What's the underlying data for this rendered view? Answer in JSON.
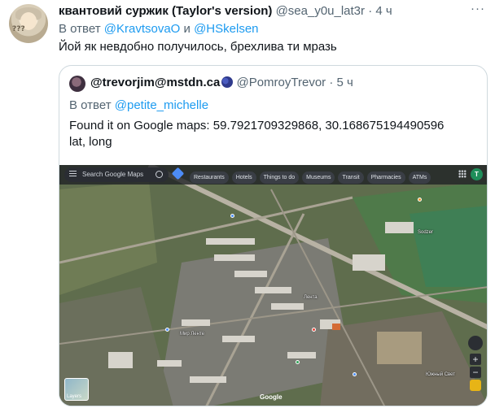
{
  "tweet": {
    "display_name": "квантовий суржик (Taylor's version)",
    "handle": "@sea_y0u_lat3r",
    "separator": "·",
    "time": "4 ч",
    "more_label": "···",
    "reply_prefix": "В ответ",
    "reply_user1": "@KravtsovaO",
    "reply_conj": "и",
    "reply_user2": "@HSkelsen",
    "text": "Йой як невдобно получилось, брехлива ти мразь"
  },
  "quoted": {
    "display_name": "@trevorjim@mstdn.ca",
    "handle": "@PomroyTrevor",
    "separator": "·",
    "time": "5 ч",
    "reply_prefix": "В ответ",
    "reply_user": "@petite_michelle",
    "text_line1": "Found it on Google maps: 59.7921709329868, 30.168675194490596",
    "text_line2": "lat, long"
  },
  "map": {
    "search_placeholder": "Search Google Maps",
    "chips": [
      "Restaurants",
      "Hotels",
      "Things to do",
      "Museums",
      "Transit",
      "Pharmacies",
      "ATMs"
    ],
    "user_initial": "T",
    "layers_label": "Layers",
    "google_label": "Google",
    "zoom_in": "+",
    "zoom_out": "−",
    "place_labels": [
      "Мир Ленте",
      "Лента",
      "Южный Свет",
      "Sodzer"
    ]
  }
}
